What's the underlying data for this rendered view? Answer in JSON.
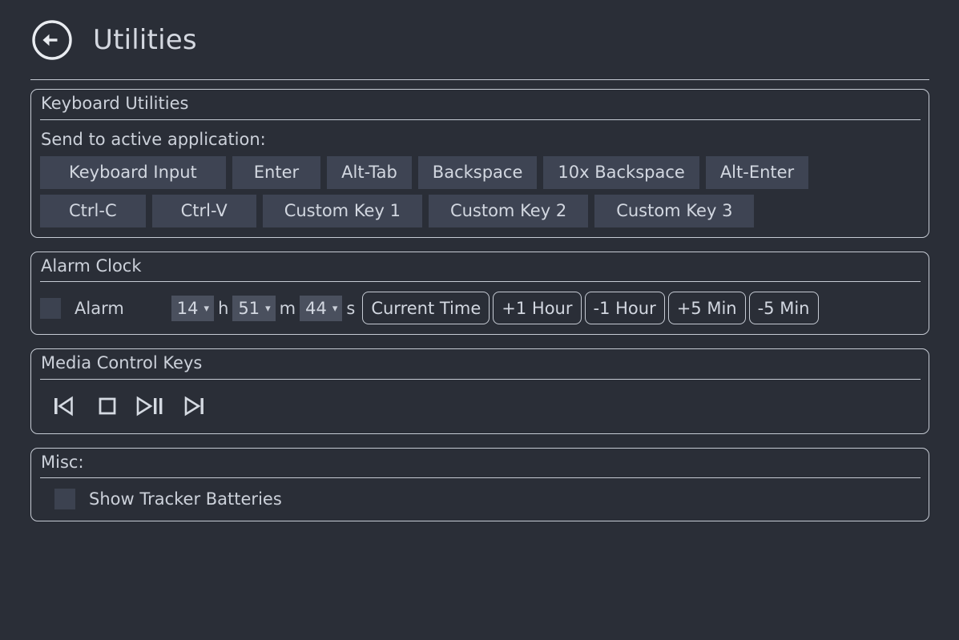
{
  "header": {
    "back_icon": "back-arrow-circle-icon",
    "title": "Utilities"
  },
  "keyboard_utilities": {
    "title": "Keyboard Utilities",
    "send_label": "Send to active application:",
    "row1": [
      {
        "label": "Keyboard Input",
        "size": "wide"
      },
      {
        "label": "Enter",
        "size": "mid"
      },
      {
        "label": "Alt-Tab",
        "size": "normal"
      },
      {
        "label": "Backspace",
        "size": "normal"
      },
      {
        "label": "10x Backspace",
        "size": "normal"
      },
      {
        "label": "Alt-Enter",
        "size": "normal"
      }
    ],
    "row2": [
      {
        "label": "Ctrl-C",
        "size": "wide"
      },
      {
        "label": "Ctrl-V",
        "size": "wide"
      },
      {
        "label": "Custom Key 1",
        "size": "mid"
      },
      {
        "label": "Custom Key 2",
        "size": "normal"
      },
      {
        "label": "Custom Key 3",
        "size": "normal"
      }
    ]
  },
  "alarm_clock": {
    "title": "Alarm Clock",
    "checkbox_label": "Alarm",
    "checkbox_checked": false,
    "hour_value": "14",
    "hour_unit": "h",
    "minute_value": "51",
    "minute_unit": "m",
    "second_value": "44",
    "second_unit": "s",
    "chevron_icon": "chevron-down-icon",
    "buttons": [
      "Current Time",
      "+1 Hour",
      "-1 Hour",
      "+5 Min",
      "-5 Min"
    ]
  },
  "media_control": {
    "title": "Media Control Keys",
    "buttons": [
      {
        "name": "previous-track-icon",
        "glyph": "|◁"
      },
      {
        "name": "stop-icon",
        "glyph": "□"
      },
      {
        "name": "play-pause-icon",
        "glyph": "▷||"
      },
      {
        "name": "next-track-icon",
        "glyph": "▷|"
      }
    ]
  },
  "misc": {
    "title": "Misc:",
    "checkbox_label": "Show Tracker Batteries",
    "checkbox_checked": false
  },
  "colors": {
    "page_background": "#2a2e37",
    "border": "#c6cbd4",
    "button_background": "#3e4453",
    "combo_background": "#4a505e",
    "checkbox_background": "#3c4250",
    "text": "#ccd1da"
  }
}
